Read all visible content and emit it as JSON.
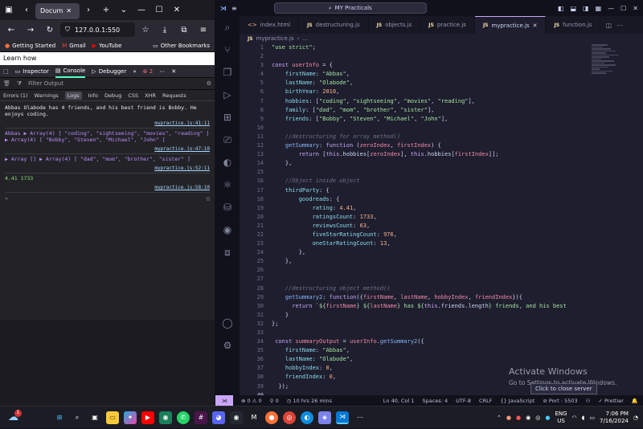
{
  "browser": {
    "tab_title": "Docum",
    "url": "127.0.0.1:550",
    "bookmarks": [
      "Getting Started",
      "Gmail",
      "YouTube"
    ],
    "other_bookmarks": "Other Bookmarks",
    "page_text": "Learn how",
    "devtools": {
      "tabs": [
        "Inspector",
        "Console",
        "Debugger"
      ],
      "error_count": "2",
      "filter_placeholder": "Filter Output",
      "levels": [
        "Errors (1)",
        "Warnings",
        "Logs",
        "Info",
        "Debug",
        "CSS",
        "XHR",
        "Requests"
      ],
      "messages": [
        {
          "text": "Abbas Olabode has 4 friends, and his best friend is Bobby. He enjoys coding.",
          "source": "mypractice.js:41:11"
        },
        {
          "text": "Abbas ▶ Array(4) [ \"coding\", \"sightseeing\", \"movies\", \"reading\" ] ▶ Array(4) [ \"Bobby\", \"Steven\", \"Michael\", \"John\" ]",
          "source": "mypractice.js:47:10"
        },
        {
          "text": "▶ Array [] ▶ Array(4) [ \"dad\", \"mom\", \"brother\", \"sister\" ]",
          "source": "mypractice.js:52:11"
        },
        {
          "text": "4.41 1733",
          "source": "mypractice.js:58:10"
        }
      ],
      "prompt": "»"
    }
  },
  "vscode": {
    "search": "MY Practicals",
    "tabs": [
      "index.html",
      "destructuring.js",
      "objects.js",
      "practice.js",
      "mypractice.js",
      "function.js"
    ],
    "active_tab": "mypractice.js",
    "breadcrumb": "mypractice.js",
    "breadcrumb_tail": "...",
    "status": {
      "problems": "⊗ 0 ⚠ 0",
      "ports": "0",
      "time": "10 hrs 26 mins",
      "position": "Ln 40, Col 1",
      "spaces": "Spaces: 4",
      "encoding": "UTF-8",
      "eol": "CRLF",
      "language": "{} JavaScript",
      "port": "⊘ Port : 5503",
      "prettier": "✓ Prettier"
    },
    "tooltip": "Click to close server"
  },
  "watermark": {
    "title": "Activate Windows",
    "subtitle": "Go to Settings to activate Windows."
  },
  "taskbar": {
    "lang": "ENG",
    "region": "US",
    "time": "7:06 PM",
    "date": "7/16/2024",
    "weather_badge": "1"
  }
}
